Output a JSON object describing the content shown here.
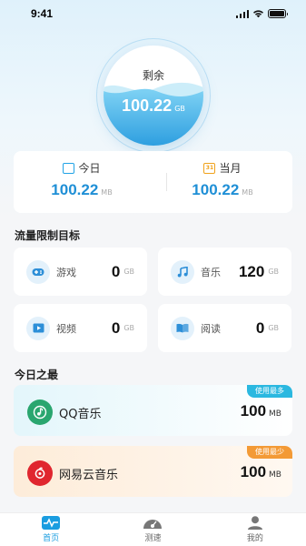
{
  "status": {
    "time": "9:41"
  },
  "orb": {
    "label": "剩余",
    "value": "100.22",
    "unit": "GB"
  },
  "summary": {
    "today": {
      "label": "今日",
      "value": "100.22",
      "unit": "MB",
      "icon": "calendar-icon"
    },
    "month": {
      "label": "当月",
      "value": "100.22",
      "unit": "MB",
      "icon": "calendar-31-icon",
      "cal_num": "31"
    }
  },
  "limits": {
    "title": "流量限制目标",
    "items": [
      {
        "name": "游戏",
        "value": "0",
        "unit": "GB",
        "icon": "gamepad-icon"
      },
      {
        "name": "音乐",
        "value": "120",
        "unit": "GB",
        "icon": "music-note-icon"
      },
      {
        "name": "视频",
        "value": "0",
        "unit": "GB",
        "icon": "video-icon"
      },
      {
        "name": "阅读",
        "value": "0",
        "unit": "GB",
        "icon": "book-icon"
      }
    ]
  },
  "top_today": {
    "title": "今日之最",
    "apps": [
      {
        "name": "QQ音乐",
        "value": "100",
        "unit": "MB",
        "badge": "使用最多",
        "icon": "qq-music-icon"
      },
      {
        "name": "网易云音乐",
        "value": "100",
        "unit": "MB",
        "badge": "使用最少",
        "icon": "netease-music-icon"
      }
    ]
  },
  "tabs": [
    {
      "label": "首页",
      "icon": "pulse-icon",
      "active": true
    },
    {
      "label": "测速",
      "icon": "speedometer-icon",
      "active": false
    },
    {
      "label": "我的",
      "icon": "user-icon",
      "active": false
    }
  ],
  "colors": {
    "accent": "#1a9de0",
    "value_blue": "#1f8fd6",
    "orange": "#f39a36",
    "netease_red": "#e0262f",
    "qq_green": "#2aa66f"
  }
}
